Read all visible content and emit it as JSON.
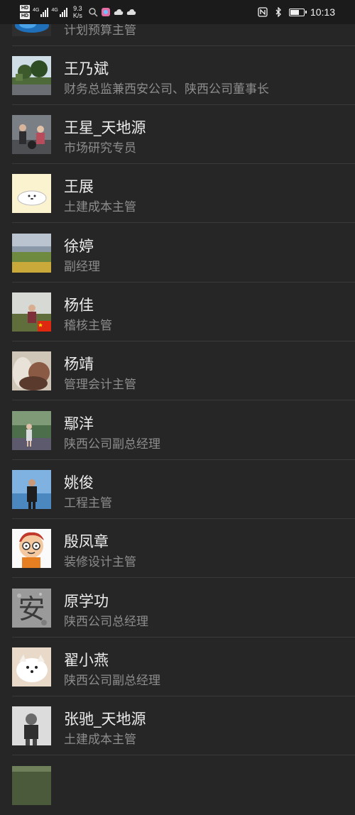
{
  "status_bar": {
    "hd_badges": [
      "HD",
      "HD"
    ],
    "network_labels": [
      "4G",
      "4G"
    ],
    "speed_value": "9.3",
    "speed_unit": "K/s",
    "time": "10:13",
    "icons": [
      "search-icon",
      "app-icon",
      "cloud-icon",
      "cloud-icon",
      "nfc-icon",
      "bluetooth-icon",
      "battery-icon"
    ]
  },
  "contacts": [
    {
      "name": "",
      "title": "计划预算主管",
      "avatar": "blue-partial"
    },
    {
      "name": "王乃斌",
      "title": "财务总监兼西安公司、陕西公司董事长",
      "avatar": "park-trees"
    },
    {
      "name": "王星_天地源",
      "title": "市场研究专员",
      "avatar": "people-outdoor"
    },
    {
      "name": "王展",
      "title": "土建成本主管",
      "avatar": "cartoon-seal"
    },
    {
      "name": "徐婷",
      "title": "副经理",
      "avatar": "landscape-field"
    },
    {
      "name": "杨佳",
      "title": "稽核主管",
      "avatar": "person-flag"
    },
    {
      "name": "杨靖",
      "title": "管理会计主管",
      "avatar": "blurred-portrait"
    },
    {
      "name": "鄢洋",
      "title": "陕西公司副总经理",
      "avatar": "person-park"
    },
    {
      "name": "姚俊",
      "title": "工程主管",
      "avatar": "person-lake"
    },
    {
      "name": "殷凤章",
      "title": "装修设计主管",
      "avatar": "cartoon-boy"
    },
    {
      "name": "原学功",
      "title": "陕西公司总经理",
      "avatar": "stone-character",
      "avatar_text": "安"
    },
    {
      "name": "翟小燕",
      "title": "陕西公司副总经理",
      "avatar": "white-dog"
    },
    {
      "name": "张驰_天地源",
      "title": "土建成本主管",
      "avatar": "child-photo"
    },
    {
      "name": "",
      "title": "",
      "avatar": "partial"
    }
  ]
}
